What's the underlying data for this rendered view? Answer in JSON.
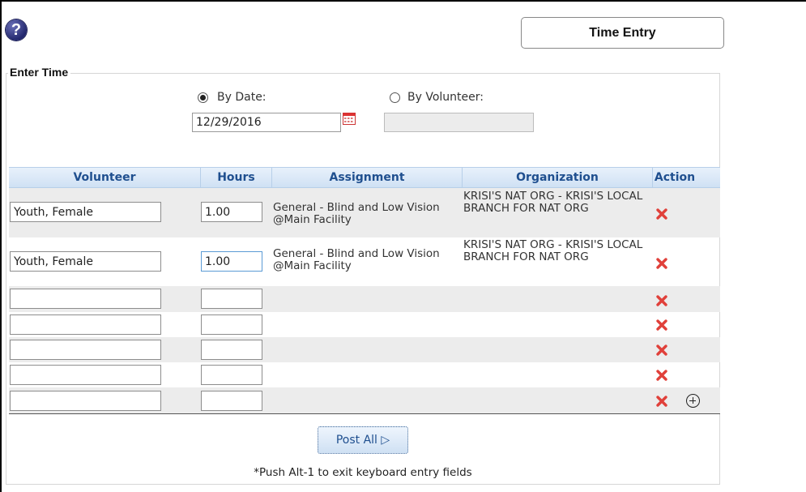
{
  "page": {
    "title": "Time Entry",
    "help_icon": "question-circle-icon"
  },
  "enter_time": {
    "legend": "Enter Time",
    "by_date_label": "By Date:",
    "by_volunteer_label": "By Volunteer:",
    "selected_mode": "By Date",
    "date_value": "12/29/2016",
    "volunteer_value": ""
  },
  "grid": {
    "headers": [
      "Volunteer",
      "Hours",
      "Assignment",
      "Organization",
      "Action"
    ],
    "rows": [
      {
        "volunteer": "Youth, Female",
        "hours": "1.00",
        "assignment": "General - Blind and Low Vision @Main Facility",
        "organization": "KRISI'S NAT ORG - KRISI'S LOCAL BRANCH FOR NAT ORG"
      },
      {
        "volunteer": "Youth, Female",
        "hours": "1.00",
        "assignment": "General - Blind and Low Vision @Main Facility",
        "organization": "KRISI'S NAT ORG - KRISI'S LOCAL BRANCH FOR NAT ORG"
      },
      {
        "volunteer": "",
        "hours": "",
        "assignment": "",
        "organization": ""
      },
      {
        "volunteer": "",
        "hours": "",
        "assignment": "",
        "organization": ""
      },
      {
        "volunteer": "",
        "hours": "",
        "assignment": "",
        "organization": ""
      },
      {
        "volunteer": "",
        "hours": "",
        "assignment": "",
        "organization": ""
      },
      {
        "volunteer": "",
        "hours": "",
        "assignment": "",
        "organization": ""
      }
    ],
    "action_icons": {
      "delete": "red-x-icon",
      "add": "plus-circle-icon"
    }
  },
  "footer": {
    "post_all_label": "Post All ▷",
    "note": "*Push Alt-1 to exit keyboard entry fields"
  },
  "colors": {
    "header_text": "#1f4f8f",
    "row_shade": "#ececec",
    "delete_red": "#e0403a"
  }
}
